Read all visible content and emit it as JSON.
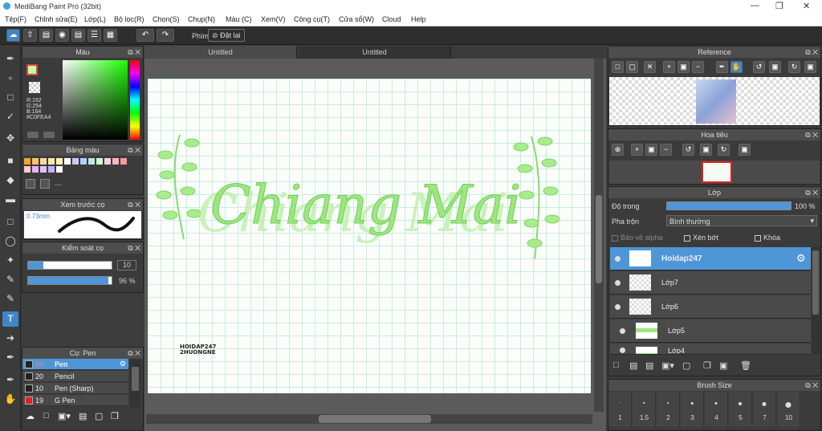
{
  "window": {
    "title": "MediBang Paint Pro (32bit)"
  },
  "menu": [
    "Tệp(F)",
    "Chỉnh sửa(E)",
    "Lớp(L)",
    "Bộ lọc(R)",
    "Chọn(S)",
    "Chụp(N)",
    "Màu (C)",
    "Xem(V)",
    "Công cụ(T)",
    "Cửa sổ(W)",
    "Cloud",
    "Help"
  ],
  "toolbar": {
    "phim_label": "Phím",
    "reset_label": "Đặt lại"
  },
  "tabs": [
    "Untitled",
    "Untitled"
  ],
  "color_panel": {
    "title": "Màu",
    "rgb_r": "R:192",
    "rgb_g": "G:254",
    "rgb_b": "B:164",
    "hex": "#C0FEA4",
    "main_color": "#C0FEA4"
  },
  "palette_panel": {
    "title": "Bảng màu",
    "more": "---",
    "swatches": [
      "#f5a623",
      "#f7c46c",
      "#f9d99b",
      "#f8e7a8",
      "#fff3b0",
      "#ffffff",
      "#c8c8ff",
      "#b0d0ff",
      "#b8ecd8",
      "#d0ffd0",
      "#ffd0e0",
      "#ffb0c0",
      "#ff9a9a",
      "#ffcccc",
      "#f0b0ff",
      "#e0c0ff",
      "#c0b0ff",
      "#fff"
    ]
  },
  "brush_preview": {
    "title": "Xem trước cọ",
    "size_label": "0.73mm"
  },
  "brush_control": {
    "title": "Kiểm soát cọ",
    "size_value": "10",
    "opacity_value": "96",
    "opacity_unit": "%",
    "opacity_fraction": 0.96
  },
  "brush_panel": {
    "title": "Cọ: Pen",
    "items": [
      {
        "size": "10",
        "name": "Pen",
        "color": "#222222"
      },
      {
        "size": "20",
        "name": "Pencil",
        "color": "#222222"
      },
      {
        "size": "10",
        "name": "Pen (Sharp)",
        "color": "#222222"
      },
      {
        "size": "19",
        "name": "G Pen",
        "color": "#e02020"
      }
    ]
  },
  "canvas": {
    "main_text": "Chiang Mai",
    "watermark_line1": "HOIDAP247",
    "watermark_line2": "2HUONGNE"
  },
  "reference_panel": {
    "title": "Reference"
  },
  "navigator_panel": {
    "title": "Hoa tiêu"
  },
  "layer_panel": {
    "title": "Lớp",
    "opacity_label": "Độ trong",
    "opacity_value": "100 %",
    "opacity_fraction": 1.0,
    "blend_label": "Pha trộn",
    "blend_value": "Bình thường",
    "protect_alpha": "Bảo vệ alpha",
    "clipping": "Xén bớt",
    "lock": "Khóa",
    "layers": [
      {
        "name": "Hoidap247",
        "selected": true
      },
      {
        "name": "Lớp7"
      },
      {
        "name": "Lớp6"
      },
      {
        "name": "Lớp5"
      },
      {
        "name": "Lớp4"
      }
    ]
  },
  "brush_size_panel": {
    "title": "Brush Size",
    "sizes": [
      "1",
      "1.5",
      "2",
      "3",
      "4",
      "5",
      "7",
      "10"
    ]
  }
}
